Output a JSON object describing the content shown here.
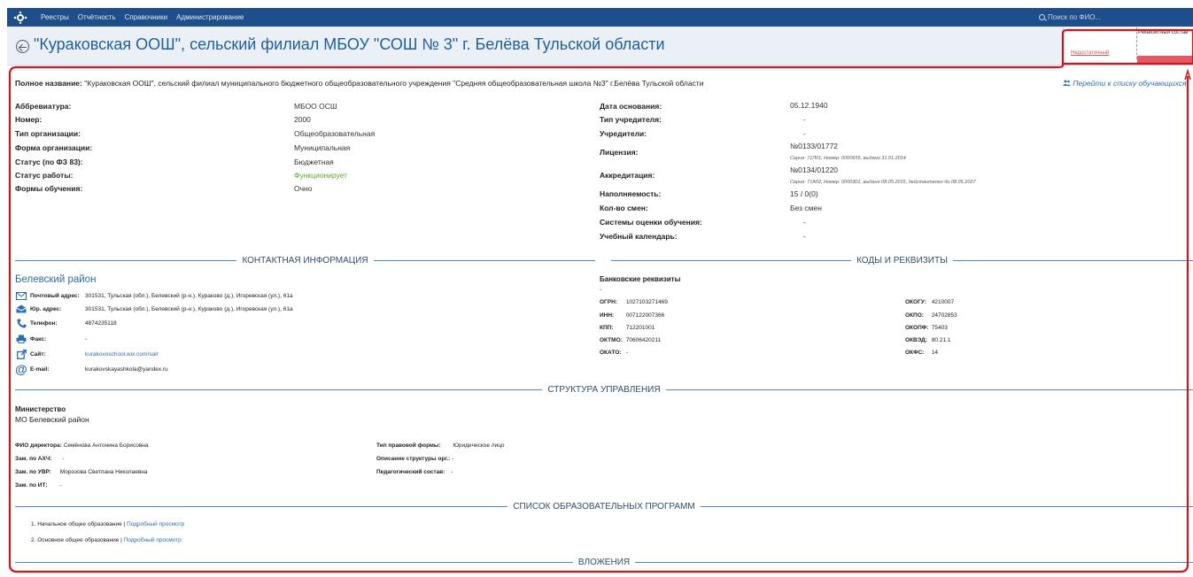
{
  "nav": {
    "items": [
      "Реестры",
      "Отчётность",
      "Справочники",
      "Администрирование"
    ],
    "search_placeholder": "Поиск по ФИО..."
  },
  "header": {
    "title": "\"Кураковская ООШ\", сельский филиал МБОУ \"СОШ № 3\" г. Белёва Тульской области"
  },
  "requisites": {
    "title": "Реквизитный состав",
    "status": "Недостаточный"
  },
  "full_name": {
    "label": "Полное название:",
    "value": "\"Кураковская ООШ\", сельский филиал муниципального бюджетного общеобразовательного учреждения \"Средняя общеобразовательная школа №3\" г.Белёва Тульской области"
  },
  "students_link": "Перейти к списку обучающихся",
  "left_fields": [
    {
      "label": "Аббревиатура:",
      "value": "МБОО ОСШ"
    },
    {
      "label": "Номер:",
      "value": "2000"
    },
    {
      "label": "Тип организации:",
      "value": "Общеобразовательная"
    },
    {
      "label": "Форма организации:",
      "value": "Муниципальная"
    },
    {
      "label": "Статус (по ФЗ 83):",
      "value": "Бюджетная"
    },
    {
      "label": "Статус работы:",
      "value": "Функционирует"
    },
    {
      "label": "Формы обучения:",
      "value": "Очно"
    }
  ],
  "right_fields": {
    "founded": {
      "label": "Дата основания:",
      "value": "05.12.1940"
    },
    "founder_type": {
      "label": "Тип учредителя:",
      "value": "-"
    },
    "founders": {
      "label": "Учредители:",
      "value": "-"
    },
    "license": {
      "label": "Лицензия:",
      "value": "№0133/01772",
      "note": "Серия: 71Л01, Номер: 0000655, выдано 31.01.2014"
    },
    "accreditation": {
      "label": "Аккредитация:",
      "value": "№0134/01220",
      "note": "Серия: 71А02, Номер: 0000301, выдано 08.05.2015, действителен до 08.05.2027"
    },
    "occupancy": {
      "label": "Наполняемость:",
      "value": "15 / 0(0)"
    },
    "shifts": {
      "label": "Кол-во смен:",
      "value": "Без смен"
    },
    "grading": {
      "label": "Системы оценки обучения:",
      "value": "-"
    },
    "calendar": {
      "label": "Учебный календарь:",
      "value": "-"
    }
  },
  "sections": {
    "contacts": "КОНТАКТНАЯ ИНФОРМАЦИЯ",
    "codes": "КОДЫ И РЕКВИЗИТЫ",
    "management": "СТРУКТУРА УПРАВЛЕНИЯ",
    "programs": "СПИСОК ОБРАЗОВАТЕЛЬНЫХ ПРОГРАММ",
    "attachments": "ВЛОЖЕНИЯ"
  },
  "contacts": {
    "district": "Белевский район",
    "postal": {
      "label": "Почтовый адрес:",
      "value": "301531, Тульская (обл.), Белевский (р-н.), Кураково (д.), Игоревская (ул.), 61а"
    },
    "legal": {
      "label": "Юр. адрес:",
      "value": "301531, Тульская (обл.), Белевский (р-н.), Кураково (д.), Игоревская (ул.), 61а"
    },
    "phone": {
      "label": "Телефон:",
      "value": "4874235118"
    },
    "fax": {
      "label": "Факс:",
      "value": "-"
    },
    "site": {
      "label": "Сайт:",
      "value": "kurakovoschool.wix.com/sait"
    },
    "email": {
      "label": "E-mail:",
      "value": "kurakovskayashkola@yandex.ru"
    }
  },
  "codes": {
    "bank_title": "Банковские реквизиты",
    "bank_value": "-",
    "left": [
      {
        "label": "ОГРН:",
        "value": "1027103271469"
      },
      {
        "label": "ИНН:",
        "value": "007122007366"
      },
      {
        "label": "КПП:",
        "value": "712201001"
      },
      {
        "label": "ОКТМО:",
        "value": "70606420211"
      },
      {
        "label": "ОКАТО:",
        "value": "-"
      }
    ],
    "right": [
      {
        "label": "ОКОГУ:",
        "value": "4210007"
      },
      {
        "label": "ОКПО:",
        "value": "24702853"
      },
      {
        "label": "ОКОПФ:",
        "value": "75403"
      },
      {
        "label": "ОКВЭД:",
        "value": "80.21.1"
      },
      {
        "label": "ОКФС:",
        "value": "14"
      }
    ]
  },
  "management": {
    "ministry_label": "Министерство",
    "ministry_value": "МО Белевский район",
    "left": [
      {
        "label": "ФИО директора:",
        "value": "Семёнова Антонина Борисовна"
      },
      {
        "label": "Зам. по АХЧ:",
        "value": "-"
      },
      {
        "label": "Зам. по УВР:",
        "value": "Морозова Светлана Николаевна"
      },
      {
        "label": "Зам. по ИТ:",
        "value": "-"
      }
    ],
    "right": [
      {
        "label": "Тип правовой формы:",
        "value": "Юридическое лицо"
      },
      {
        "label": "Описание структуры орг.:",
        "value": "-"
      },
      {
        "label": "Педагогический состав:",
        "value": "-"
      }
    ]
  },
  "programs": [
    {
      "name": "1.  Начальное общее образование",
      "link": "Подробный просмотр"
    },
    {
      "name": "2.  Основное общее образование",
      "link": "Подробный просмотр"
    }
  ],
  "colors": {
    "nav_bg": "#1e4f8a",
    "accent_blue": "#2d6db5",
    "annotation_red": "#d7141a",
    "status_green": "#5aa832"
  }
}
